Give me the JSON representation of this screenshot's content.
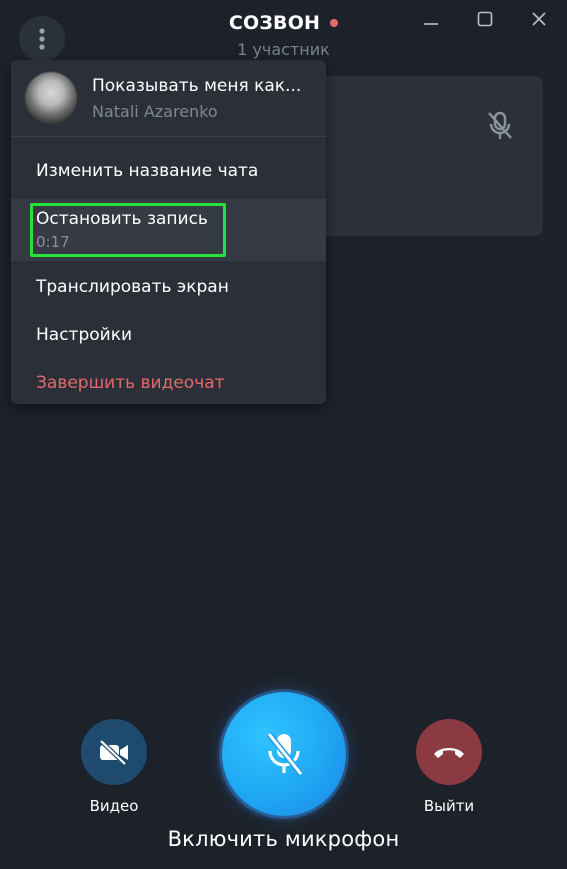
{
  "header": {
    "title": "СОЗВОН",
    "subtitle": "1 участник"
  },
  "menu": {
    "profile": {
      "name": "Показывать меня как...",
      "subtitle": "Natali Azarenko"
    },
    "items": {
      "rename": "Изменить название чата",
      "stop_recording": "Остановить запись",
      "recording_time": "0:17",
      "share_screen": "Транслировать экран",
      "settings": "Настройки",
      "end_call": "Завершить видеочат"
    }
  },
  "controls": {
    "video_label": "Видео",
    "leave_label": "Выйти",
    "mic_label": "Включить микрофон"
  },
  "colors": {
    "background": "#1d222a",
    "menu_bg": "#2b3038",
    "accent_blue": "#1fa7f3",
    "danger": "#e36a6a",
    "highlight": "#27e33b"
  },
  "icons": {
    "menu": "more-vertical-icon",
    "minimize": "minimize-icon",
    "maximize": "maximize-icon",
    "close": "close-icon",
    "tile_mic": "mic-off-icon",
    "video": "video-off-icon",
    "mic": "mic-off-icon",
    "leave": "phone-hangup-icon"
  }
}
